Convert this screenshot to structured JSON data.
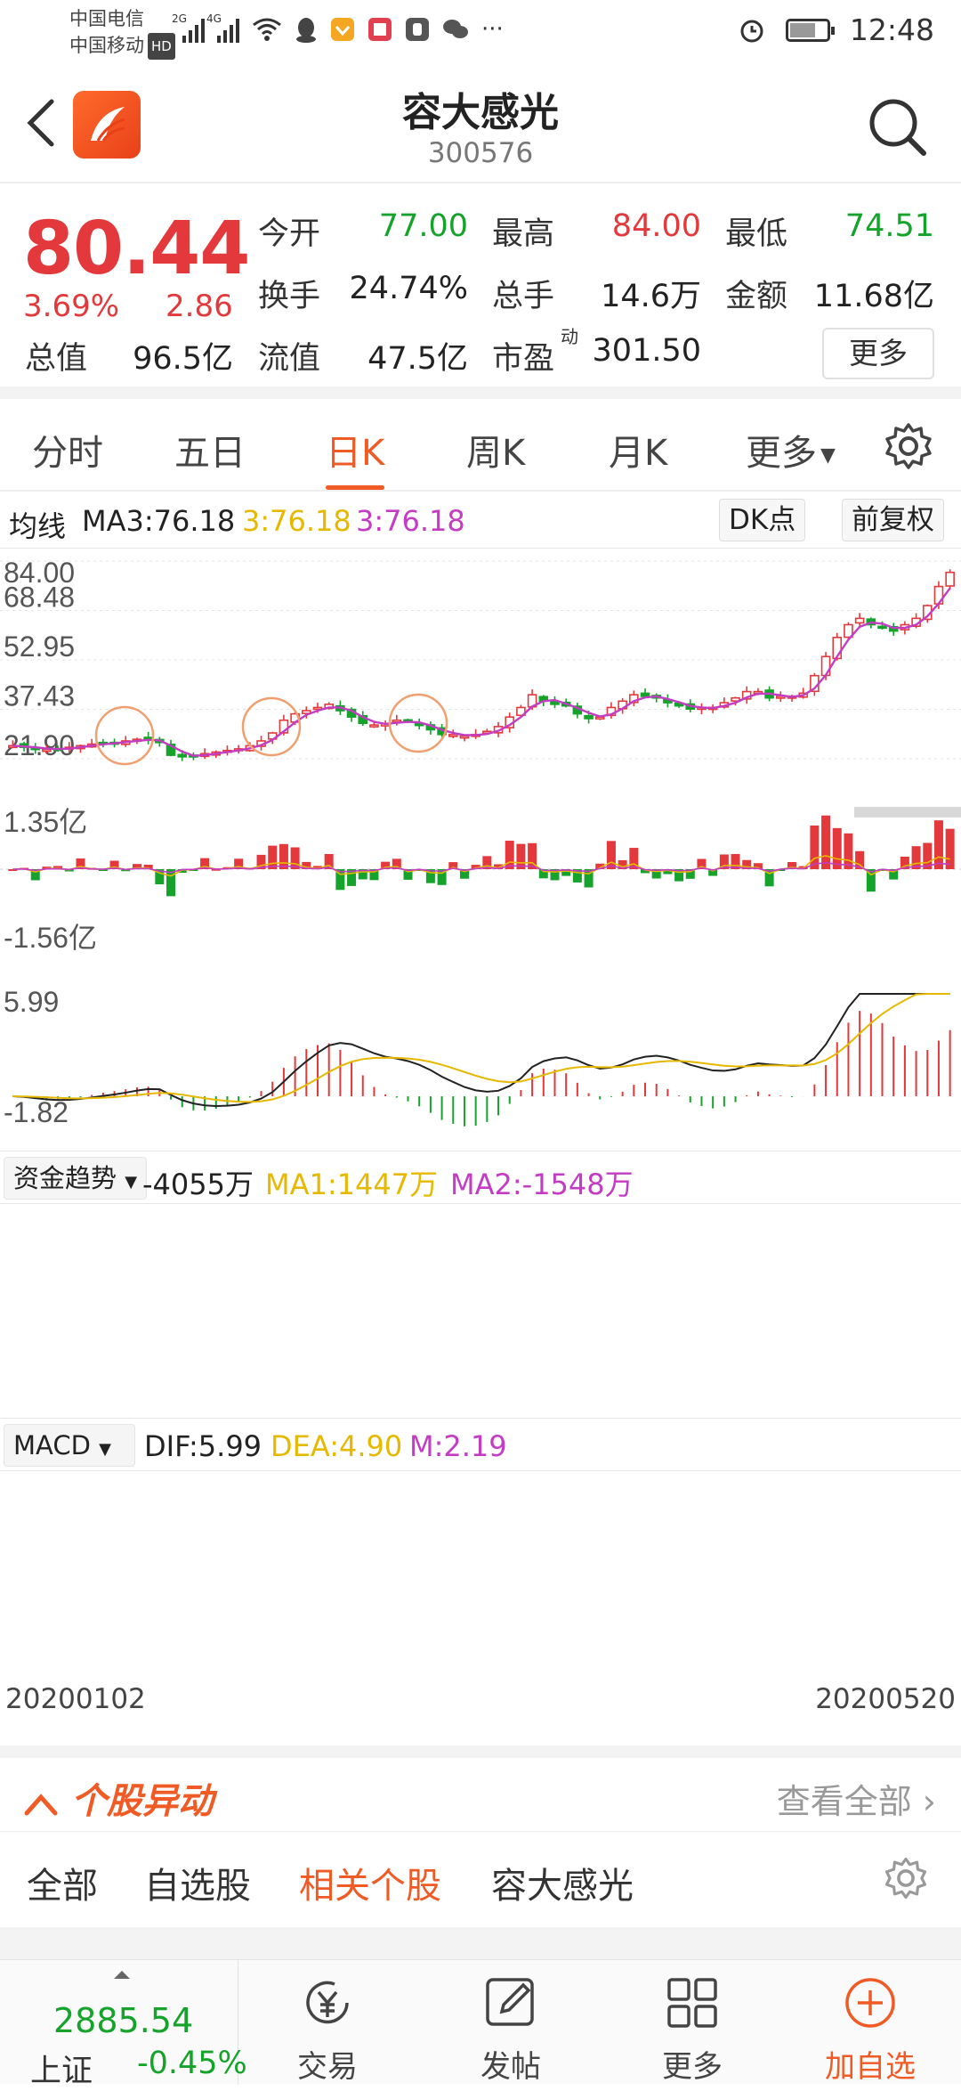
{
  "status": {
    "carrier1": "中国电信",
    "carrier2": "中国移动",
    "hd": "HD",
    "net1": "2G",
    "net2": "4G",
    "time": "12:48"
  },
  "header": {
    "title": "容大感光",
    "code": "300576"
  },
  "quote": {
    "price": "80.44",
    "change_pct": "3.69%",
    "change": "2.86",
    "open_label": "今开",
    "open": "77.00",
    "high_label": "最高",
    "high": "84.00",
    "low_label": "最低",
    "low": "74.51",
    "turnover_label": "换手",
    "turnover": "24.74%",
    "volume_label": "总手",
    "volume": "14.6万",
    "amount_label": "金额",
    "amount": "11.68亿",
    "mktcap_label": "总值",
    "mktcap": "96.5亿",
    "float_label": "流值",
    "float": "47.5亿",
    "pe_label": "市盈",
    "pe_sup": "动",
    "pe": "301.50",
    "more_label": "更多"
  },
  "tabs": [
    "分时",
    "五日",
    "日K",
    "周K",
    "月K",
    "更多"
  ],
  "ma_header": {
    "label": "均线",
    "ma3_white": "MA3:76.18",
    "ma3_yellow": "3:76.18",
    "ma3_purple": "3:76.18",
    "dk_label": "DK点",
    "adjust_label": "前复权"
  },
  "price_axis": [
    "84.00",
    "68.48",
    "52.95",
    "37.43",
    "21.90"
  ],
  "fund_header": {
    "dropdown": "资金趋势",
    "value": "-4055万",
    "ma1": "MA1:1447万",
    "ma2": "MA2:-1548万",
    "top": "1.35亿",
    "bottom": "-1.56亿"
  },
  "macd_header": {
    "dropdown": "MACD",
    "dif": "DIF:5.99",
    "dea": "DEA:4.90",
    "m": "M:2.19",
    "top": "5.99",
    "bottom": "-1.82"
  },
  "dates": {
    "start": "20200102",
    "end": "20200520"
  },
  "alert": {
    "title": "个股异动",
    "view_all": "查看全部"
  },
  "filters": [
    "全部",
    "自选股",
    "相关个股",
    "容大感光"
  ],
  "bottom": {
    "index_value": "2885.54",
    "index_name": "上证",
    "index_change": "-0.45%",
    "nav": [
      "交易",
      "发帖",
      "更多",
      "加自选"
    ]
  },
  "colors": {
    "up": "#e4393c",
    "down": "#15a32b",
    "accent": "#f05a24",
    "ma_yellow": "#e6b800",
    "ma_purple": "#c43bc4"
  },
  "chart_data": {
    "type": "candlestick",
    "x_range": [
      "20200102",
      "20200520"
    ],
    "price_ylim": [
      21.9,
      84.0
    ],
    "price_ticks": [
      84.0,
      68.48,
      52.95,
      37.43,
      21.9
    ],
    "close_series_approx": [
      26,
      25.5,
      25,
      24.8,
      25,
      25.5,
      26,
      26.5,
      26.8,
      27,
      27.5,
      28,
      28,
      27,
      23,
      22.5,
      23,
      23.5,
      24,
      24.5,
      25,
      26,
      27.5,
      30,
      34,
      36,
      37,
      38,
      39,
      37,
      35,
      33,
      32.5,
      33,
      34,
      33.5,
      32.5,
      31,
      29.5,
      29.5,
      29,
      29.5,
      30.5,
      32,
      35,
      38,
      42,
      40,
      39,
      38.5,
      36,
      34.5,
      35,
      38,
      40,
      42,
      41.5,
      41,
      39.5,
      38.5,
      37.5,
      38,
      38,
      39.5,
      41,
      43,
      43,
      41,
      41.5,
      41.5,
      42.5,
      48,
      54,
      60,
      64,
      66,
      64,
      63,
      62,
      64,
      66,
      70,
      76,
      80.44
    ],
    "fund_ylim": [
      "-1.56亿",
      "1.35亿"
    ],
    "macd_ylim": [
      -1.82,
      5.99
    ]
  }
}
